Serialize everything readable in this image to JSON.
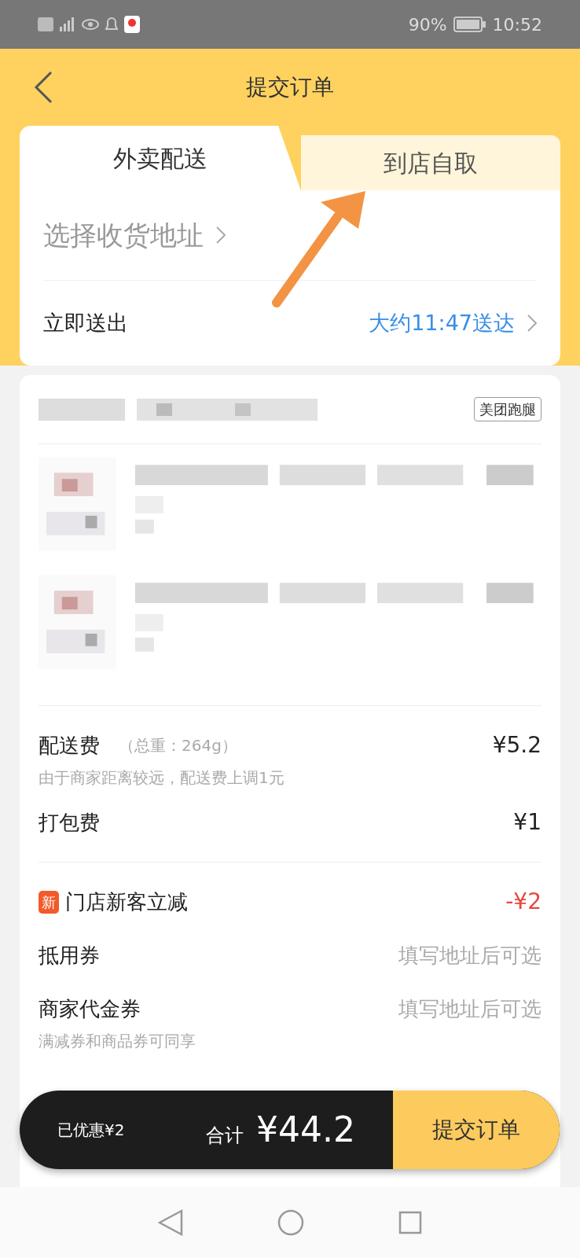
{
  "status_bar": {
    "battery": "90%",
    "time": "10:52"
  },
  "header": {
    "title": "提交订单"
  },
  "tabs": [
    {
      "label": "外卖配送",
      "selected": true
    },
    {
      "label": "到店自取",
      "selected": false
    }
  ],
  "address": {
    "label": "选择收货地址"
  },
  "delivery": {
    "label": "立即送出",
    "eta": "大约11:47送达"
  },
  "shop": {
    "tag": "美团跑腿"
  },
  "fees": [
    {
      "kind": "fee",
      "label": "配送费",
      "note": "（总重：264g）",
      "value": "¥5.2",
      "subtitle": "由于商家距离较远，配送费上调1元"
    },
    {
      "kind": "fee",
      "label": "打包费",
      "value": "¥1"
    },
    {
      "kind": "discount",
      "badge": "新",
      "label": "门店新客立减",
      "value": "-¥2"
    },
    {
      "kind": "coupon",
      "label": "抵用券",
      "placeholder": "填写地址后可选"
    },
    {
      "kind": "coupon",
      "label": "商家代金券",
      "placeholder": "填写地址后可选",
      "subtitle": "满减券和商品券可同享"
    }
  ],
  "bottom_bar": {
    "saved": "已优惠¥2",
    "total_label": "合计",
    "total": "¥44.2",
    "submit": "提交订单"
  }
}
